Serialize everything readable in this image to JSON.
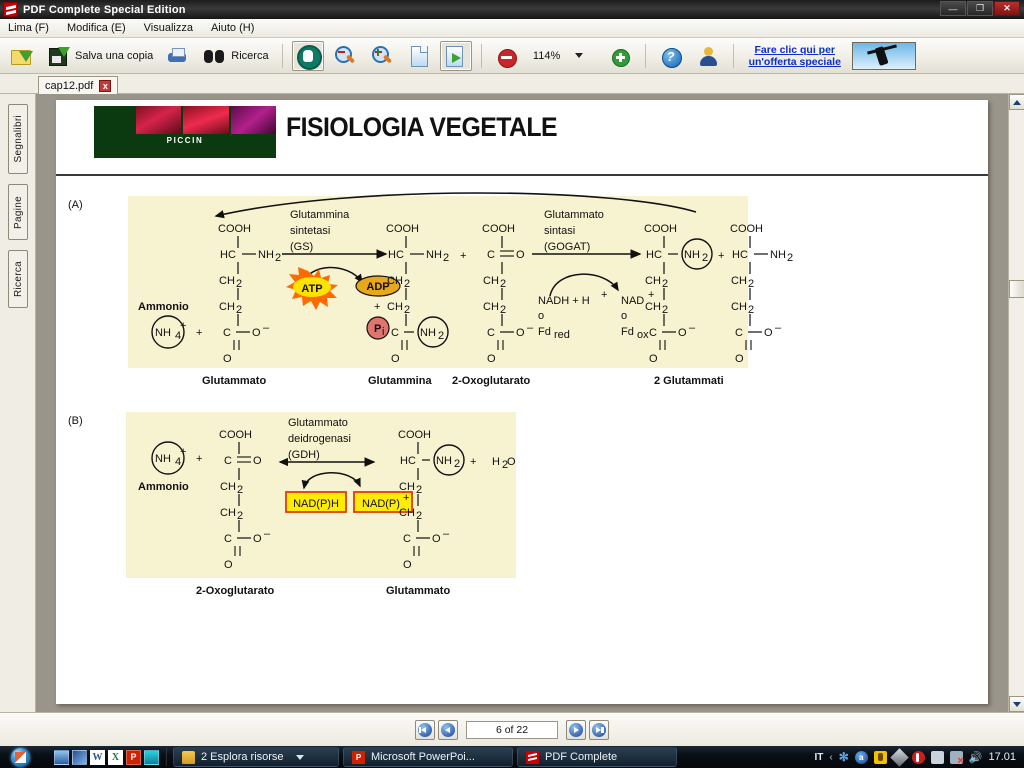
{
  "window": {
    "title": "PDF Complete Special Edition",
    "app_icon": "pdf-complete-icon",
    "minimize_label": "—",
    "maximize_label": "❐",
    "close_label": "✕"
  },
  "menubar": [
    {
      "label": "Lima (F)",
      "name": "menu-file"
    },
    {
      "label": "Modifica (E)",
      "name": "menu-edit"
    },
    {
      "label": "Visualizza",
      "name": "menu-view"
    },
    {
      "label": "Aiuto (H)",
      "name": "menu-help"
    }
  ],
  "toolbar": {
    "open_label": "",
    "save_copy_label": "Salva una copia",
    "print_label": "",
    "search_label": "Ricerca",
    "hand_label": "",
    "zoom_out_label": "",
    "zoom_in_label": "",
    "fit_page_label": "",
    "convert_label": "",
    "stop_label": "",
    "zoom_level": "114%",
    "zoom_add_label": "",
    "help_label": "",
    "account_label": "",
    "promo_line1": "Fare clic qui per",
    "promo_line2": "un'offerta speciale"
  },
  "tab": {
    "filename": "cap12.pdf",
    "close_label": "x"
  },
  "rail": [
    {
      "label": "Segnalibri",
      "name": "rail-tab-bookmarks"
    },
    {
      "label": "Pagine",
      "name": "rail-tab-pages"
    },
    {
      "label": "Ricerca",
      "name": "rail-tab-search"
    }
  ],
  "document": {
    "publisher": "PICCIN",
    "book_title": "FISIOLOGIA VEGETALE"
  },
  "figure": {
    "panel_a": {
      "letter": "(A)",
      "enzyme1_line1": "Glutammina",
      "enzyme1_line2": "sintetasi",
      "enzyme1_line3": "(GS)",
      "enzyme2_line1": "Glutammato",
      "enzyme2_line2": "sintasi",
      "enzyme2_line3": "(GOGAT)",
      "ammonio_label": "Ammonio",
      "nh4": "NH",
      "nh4_sub": "4",
      "nh4_sup": "+",
      "atp": "ATP",
      "adp": "ADP",
      "plus": "+",
      "pi": "P",
      "pi_sub": "i",
      "cofactor_in_line1": "NADH + H",
      "cofactor_in_sup": "+",
      "cofactor_in_line2": "o",
      "cofactor_in_line3": "Fd",
      "cofactor_in_line3_sub": "red",
      "cofactor_out_line1": "NAD",
      "cofactor_out_sup": "+",
      "cofactor_out_line2": "o",
      "cofactor_out_line3": "Fd",
      "cofactor_out_line3_sub": "ox",
      "structures": {
        "cooh": "COOH",
        "hc": "HC",
        "nh2": "NH",
        "nh2_sub": "2",
        "ch2": "CH",
        "ch2_sub": "2",
        "c": "C",
        "o_minus": "O",
        "o": "O",
        "c_eq_o": "C"
      },
      "captions": [
        {
          "text": "Glutammato",
          "name": "caption-glutammato"
        },
        {
          "text": "Glutammina",
          "name": "caption-glutammina"
        },
        {
          "text": "2-Oxoglutarato",
          "name": "caption-2-oxoglutarato"
        },
        {
          "text": "2 Glutammati",
          "name": "caption-2-glutammati"
        }
      ]
    },
    "panel_b": {
      "letter": "(B)",
      "enzyme_line1": "Glutammato",
      "enzyme_line2": "deidrogenasi",
      "enzyme_line3": "(GDH)",
      "ammonio_label": "Ammonio",
      "nadph": "NAD(P)H",
      "nadp_plus": "NAD(P)",
      "nadp_plus_sup": "+",
      "water": "H",
      "water_sub": "2",
      "water_o": "O",
      "plus": "+",
      "captions": [
        {
          "text": "2-Oxoglutarato",
          "name": "caption-b-2-oxoglutarato"
        },
        {
          "text": "Glutammato",
          "name": "caption-b-glutammato"
        }
      ]
    },
    "colors": {
      "panel_bg": "#f7f2cf",
      "atp_fill": "#ffe300",
      "atp_burst": "#ff6a00",
      "adp_fill": "#e8a81c",
      "pi_fill": "#e0746f",
      "nad_box_fill": "#ffec00",
      "nad_box_border": "#e03a12"
    }
  },
  "statusbar": {
    "first_label": "first-page",
    "prev_label": "previous-page",
    "page_indicator": "6 of 22",
    "next_label": "next-page",
    "last_label": "last-page"
  },
  "taskbar": {
    "start_label": "start-orb",
    "quick_launch": [
      {
        "name": "show-desktop-icon"
      },
      {
        "name": "switch-windows-icon"
      },
      {
        "name": "word-icon",
        "label": "W"
      },
      {
        "name": "excel-icon",
        "label": "X"
      },
      {
        "name": "powerpoint-icon",
        "label": "P"
      },
      {
        "name": "media-player-icon"
      }
    ],
    "items": [
      {
        "label": "2 Esplora risorse",
        "icon": "folder-icon",
        "name": "taskbar-item-explorer",
        "has_dropdown": true
      },
      {
        "label": "Microsoft PowerPoi...",
        "icon": "powerpoint-icon",
        "name": "taskbar-item-powerpoint",
        "has_dropdown": false
      },
      {
        "label": "PDF Complete",
        "icon": "pdf-complete-icon",
        "name": "taskbar-item-pdfcomplete",
        "has_dropdown": false
      }
    ],
    "tray": {
      "language": "IT",
      "chevron": "‹",
      "bluetooth": "✻",
      "clock": "17.01"
    }
  }
}
